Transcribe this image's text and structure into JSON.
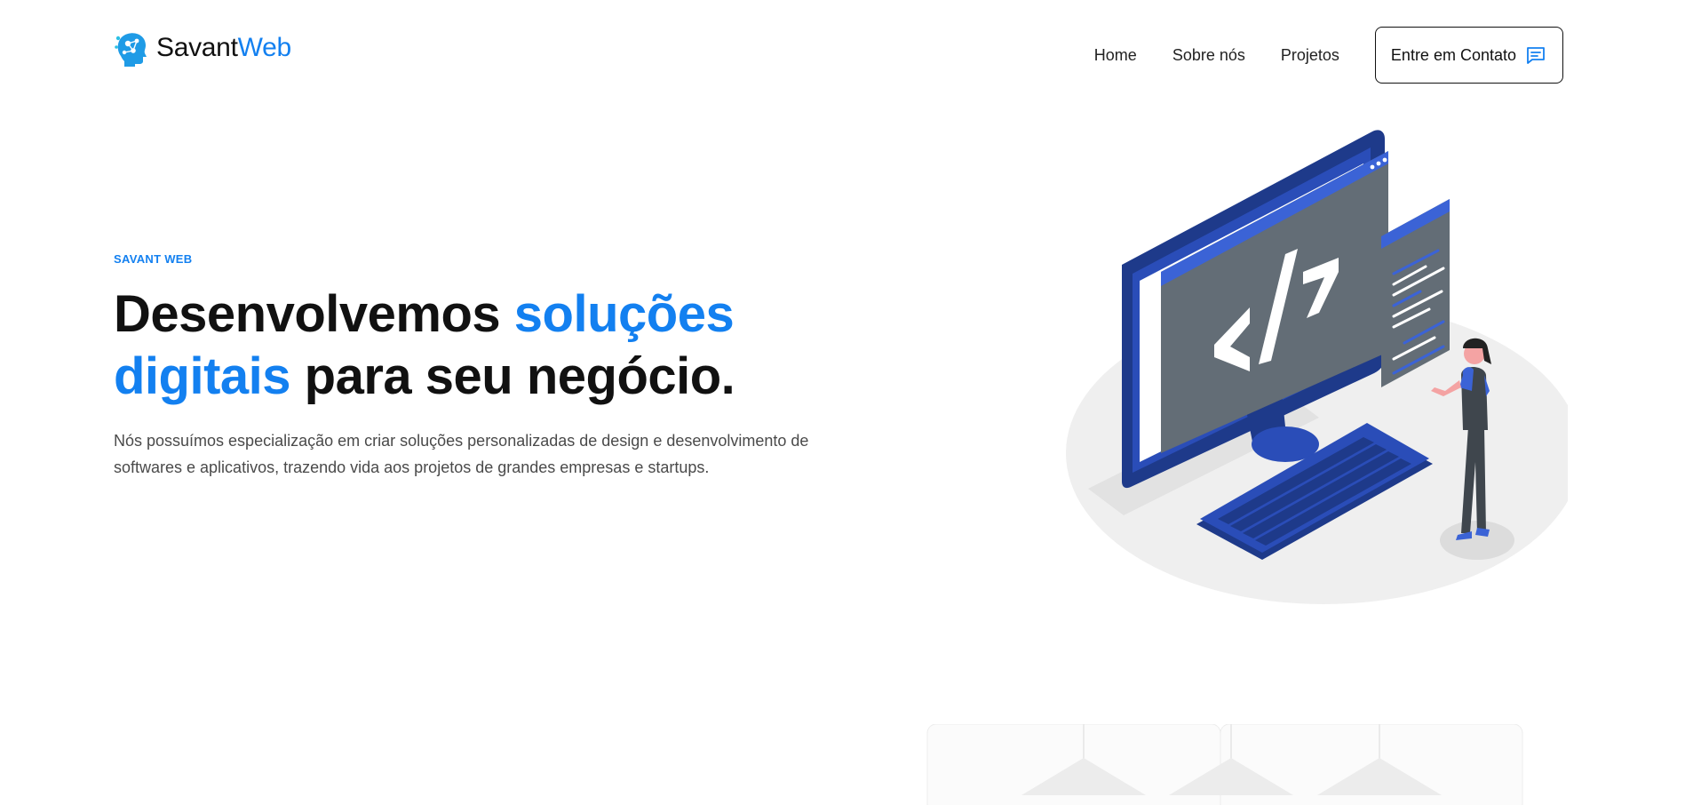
{
  "brand": {
    "name_part1": "Savant",
    "name_part2": "Web",
    "accent_color": "#1380f0",
    "icon": "brain-network-icon"
  },
  "nav": {
    "links": [
      "Home",
      "Sobre nós",
      "Projetos"
    ],
    "cta_label": "Entre em Contato",
    "cta_icon": "chat-message-icon"
  },
  "hero": {
    "eyebrow": "SAVANT WEB",
    "headline_part1": "Desenvolvemos ",
    "headline_highlight1": "soluções",
    "headline_highlight2": "digitais",
    "headline_part2": " para seu negócio.",
    "description": "Nós possuímos especialização em criar soluções personalizadas de design e desenvolvimento de softwares e aplicativos, trazendo vida aos projetos de grandes empresas e startups."
  },
  "illustration": {
    "name": "developer-computer-illustration",
    "code_symbol": "</>"
  },
  "colors": {
    "primary_blue": "#1380f0",
    "navy": "#1e3a8a",
    "illustration_blue": "#3b63d6",
    "text_dark": "#111111",
    "text_muted": "#4a4a4a"
  }
}
